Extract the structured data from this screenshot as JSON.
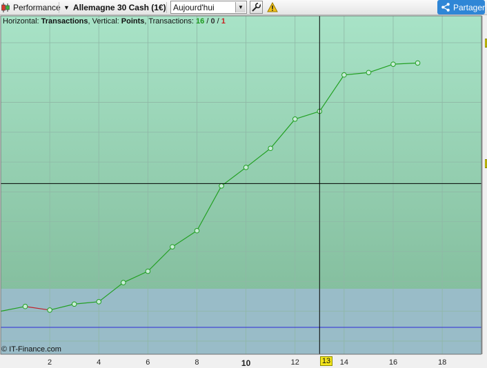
{
  "toolbar": {
    "performance_label": "Performance",
    "instrument_label": "Allemagne 30 Cash (1€)",
    "period_select_value": "Aujourd'hui",
    "share_label": "Partager"
  },
  "info": {
    "horizontal_prefix": "Horizontal: ",
    "horizontal_value": "Transactions",
    "vertical_prefix": ", Vertical: ",
    "vertical_value": "Points",
    "transactions_prefix": ", Transactions: ",
    "count_winning": "16",
    "sep1": " / ",
    "count_neutral": "0",
    "sep2": " / ",
    "count_losing": "1"
  },
  "copyright": "© IT-Finance.com",
  "cursor_label": "13",
  "colors": {
    "profit_zone_top": "#a8e3c7",
    "profit_zone_bottom": "#85bf9f",
    "loss_zone": "#99bcc8",
    "equity_line": "#22a022",
    "loss_segment": "#c0202a",
    "zero_line": "#2a2ad8",
    "crosshair": "#000000",
    "share_button": "#2f86d6"
  },
  "chart_data": {
    "type": "line",
    "xlabel": "Transactions",
    "ylabel": "Points",
    "x_ticks": [
      2,
      4,
      6,
      8,
      10,
      12,
      14,
      16,
      18
    ],
    "x_tick_labels": [
      "2",
      "4",
      "6",
      "8",
      "10",
      "12",
      "14",
      "16",
      "18"
    ],
    "xlim": [
      0,
      19.6
    ],
    "ylim": [
      -72,
      495
    ],
    "zero_line": 0,
    "grid": true,
    "crosshair": {
      "x": 13,
      "y": 214
    },
    "series": [
      {
        "x": [
          0,
          1,
          2,
          3,
          4,
          5,
          6,
          7,
          8,
          9,
          10,
          11,
          12,
          13,
          14,
          15,
          16,
          17
        ],
        "values": [
          0,
          8,
          2,
          12,
          16,
          48,
          67,
          108,
          135,
          210,
          241,
          273,
          322,
          335,
          396,
          400,
          414,
          416
        ]
      }
    ]
  }
}
